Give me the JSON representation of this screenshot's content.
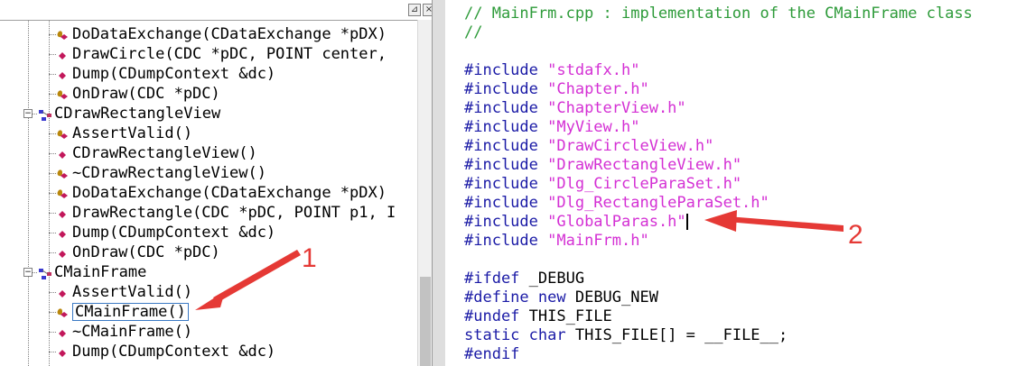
{
  "class_tree": {
    "rows": [
      {
        "depth": 2,
        "icon": "protected-method-icon",
        "label": "DoDataExchange(CDataExchange *pDX)"
      },
      {
        "depth": 2,
        "icon": "public-method-icon",
        "label": "DrawCircle(CDC *pDC, POINT center,"
      },
      {
        "depth": 2,
        "icon": "public-method-icon",
        "label": "Dump(CDumpContext &dc)"
      },
      {
        "depth": 2,
        "icon": "protected-method-icon",
        "label": "OnDraw(CDC *pDC)"
      },
      {
        "depth": 1,
        "icon": "class-icon",
        "label": "CDrawRectangleView",
        "expander": "⊟"
      },
      {
        "depth": 2,
        "icon": "protected-method-icon",
        "label": "AssertValid()"
      },
      {
        "depth": 2,
        "icon": "public-method-icon",
        "label": "CDrawRectangleView()"
      },
      {
        "depth": 2,
        "icon": "protected-method-icon",
        "label": "~CDrawRectangleView()"
      },
      {
        "depth": 2,
        "icon": "protected-method-icon",
        "label": "DoDataExchange(CDataExchange *pDX)"
      },
      {
        "depth": 2,
        "icon": "public-method-icon",
        "label": "DrawRectangle(CDC *pDC, POINT p1, I"
      },
      {
        "depth": 2,
        "icon": "public-method-icon",
        "label": "Dump(CDumpContext &dc)"
      },
      {
        "depth": 2,
        "icon": "public-method-icon",
        "label": "OnDraw(CDC *pDC)"
      },
      {
        "depth": 1,
        "icon": "class-icon",
        "label": "CMainFrame",
        "expander": "⊟"
      },
      {
        "depth": 2,
        "icon": "public-method-icon",
        "label": "AssertValid()"
      },
      {
        "depth": 2,
        "icon": "protected-method-icon",
        "label": "CMainFrame()",
        "selected": true
      },
      {
        "depth": 2,
        "icon": "public-method-icon",
        "label": "~CMainFrame()"
      },
      {
        "depth": 2,
        "icon": "public-method-icon",
        "label": "Dump(CDumpContext &dc)"
      }
    ],
    "topbar_buttons": [
      "⊿",
      "×"
    ]
  },
  "code_editor": {
    "lines": [
      [
        {
          "t": "// MainFrm.cpp : implementation of the CMainFrame class",
          "c": "comment"
        }
      ],
      [
        {
          "t": "//",
          "c": "comment"
        }
      ],
      [],
      [
        {
          "t": "#include ",
          "c": "kw"
        },
        {
          "t": "\"stdafx.h\"",
          "c": "str"
        }
      ],
      [
        {
          "t": "#include ",
          "c": "kw"
        },
        {
          "t": "\"Chapter.h\"",
          "c": "str"
        }
      ],
      [
        {
          "t": "#include ",
          "c": "kw"
        },
        {
          "t": "\"ChapterView.h\"",
          "c": "str"
        }
      ],
      [
        {
          "t": "#include ",
          "c": "kw"
        },
        {
          "t": "\"MyView.h\"",
          "c": "str"
        }
      ],
      [
        {
          "t": "#include ",
          "c": "kw"
        },
        {
          "t": "\"DrawCircleView.h\"",
          "c": "str"
        }
      ],
      [
        {
          "t": "#include ",
          "c": "kw"
        },
        {
          "t": "\"DrawRectangleView.h\"",
          "c": "str"
        }
      ],
      [
        {
          "t": "#include ",
          "c": "kw"
        },
        {
          "t": "\"Dlg_CircleParaSet.h\"",
          "c": "str"
        }
      ],
      [
        {
          "t": "#include ",
          "c": "kw"
        },
        {
          "t": "\"Dlg_RectangleParaSet.h\"",
          "c": "str"
        }
      ],
      [
        {
          "t": "#include ",
          "c": "kw"
        },
        {
          "t": "\"GlobalParas.h\"",
          "c": "str"
        },
        {
          "t": "",
          "c": "caret"
        }
      ],
      [
        {
          "t": "#include ",
          "c": "kw"
        },
        {
          "t": "\"MainFrm.h\"",
          "c": "str"
        }
      ],
      [],
      [
        {
          "t": "#ifdef ",
          "c": "kw"
        },
        {
          "t": "_DEBUG",
          "c": "plain"
        }
      ],
      [
        {
          "t": "#define ",
          "c": "kw"
        },
        {
          "t": "new ",
          "c": "kw"
        },
        {
          "t": "DEBUG_NEW",
          "c": "plain"
        }
      ],
      [
        {
          "t": "#undef ",
          "c": "kw"
        },
        {
          "t": "THIS_FILE",
          "c": "plain"
        }
      ],
      [
        {
          "t": "static ",
          "c": "kw"
        },
        {
          "t": "char ",
          "c": "kw"
        },
        {
          "t": "THIS_FILE[] = __FILE__;",
          "c": "plain"
        }
      ],
      [
        {
          "t": "#endif",
          "c": "kw"
        }
      ]
    ]
  },
  "annotations": [
    {
      "label": "1",
      "color": "#e53935"
    },
    {
      "label": "2",
      "color": "#e53935"
    }
  ]
}
